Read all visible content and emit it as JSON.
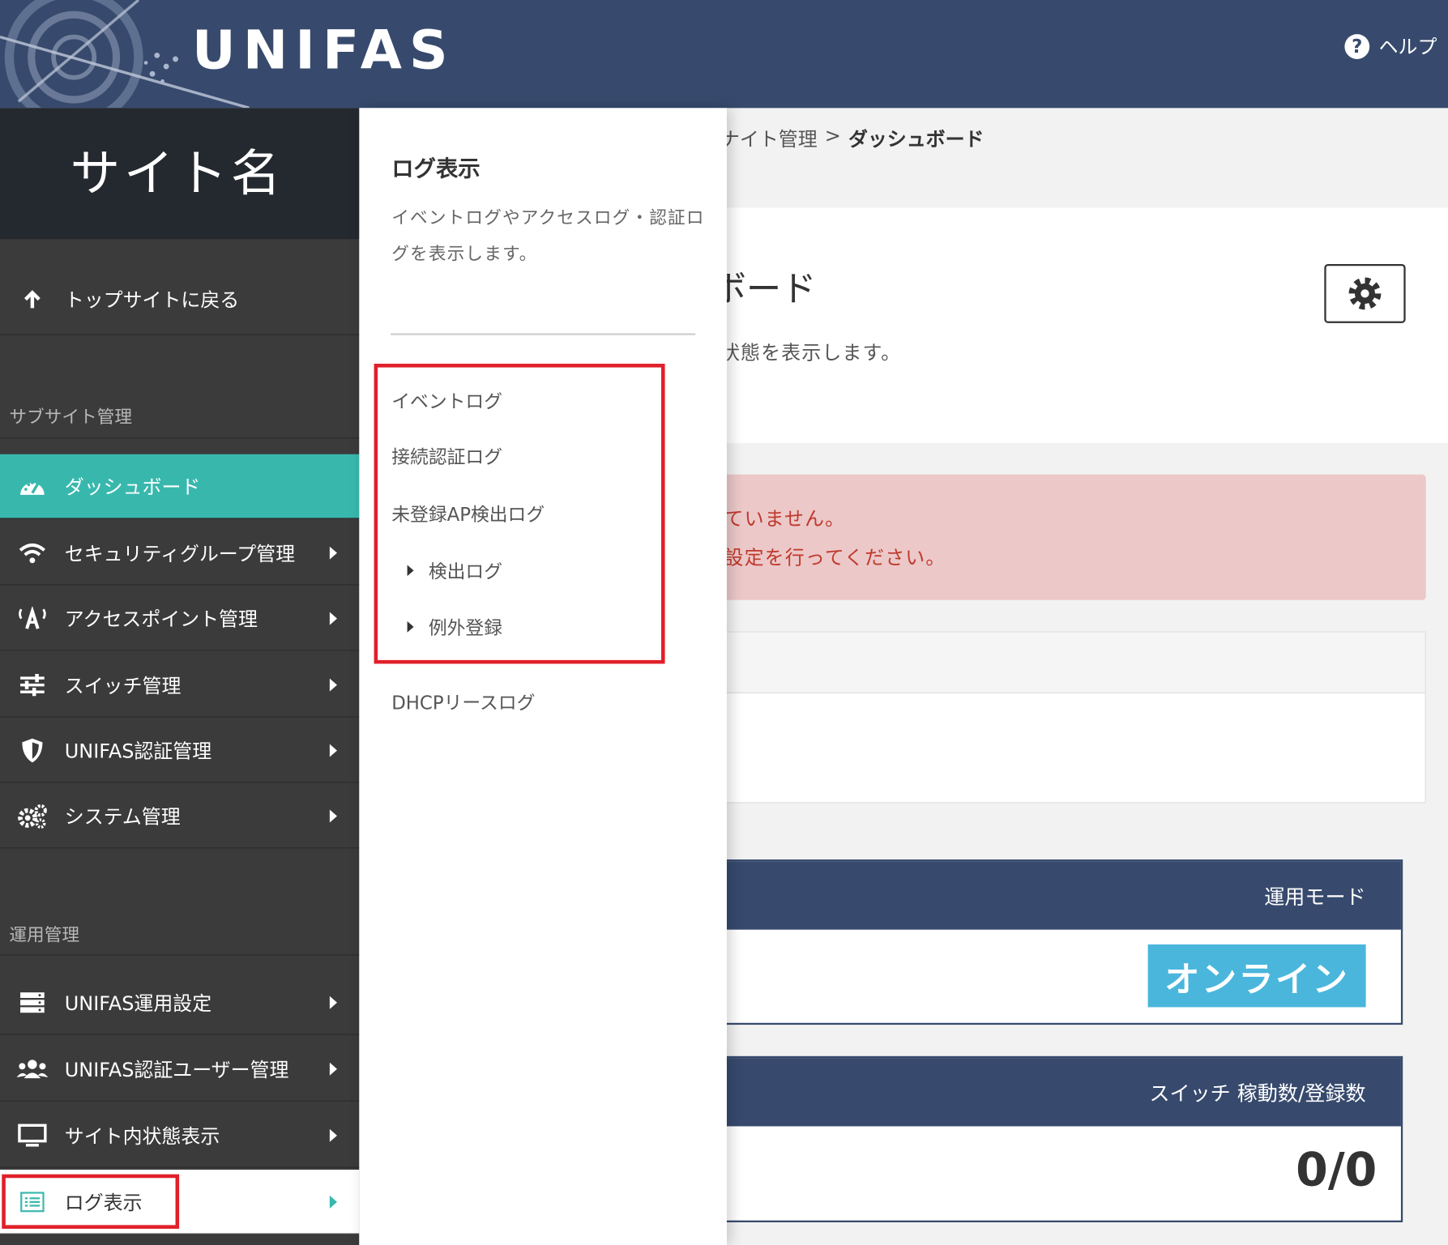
{
  "header": {
    "logo_text": "UNIFAS",
    "help_icon": "question-circle-icon",
    "help_label": "ヘルプ"
  },
  "sidebar": {
    "site_name": "サイト名",
    "back_label": "トップサイトに戻る",
    "back_icon": "arrow-up-icon",
    "section_subsite": "サブサイト管理",
    "section_ops": "運用管理",
    "items": [
      {
        "label": "ダッシュボード",
        "icon": "dashboard-gauge-icon",
        "state": "active"
      },
      {
        "label": "セキュリティグループ管理",
        "icon": "wifi-icon"
      },
      {
        "label": "アクセスポイント管理",
        "icon": "access-point-icon"
      },
      {
        "label": "スイッチ管理",
        "icon": "sliders-icon"
      },
      {
        "label": "UNIFAS認証管理",
        "icon": "shield-icon"
      },
      {
        "label": "システム管理",
        "icon": "cogs-icon"
      },
      {
        "label": "UNIFAS運用設定",
        "icon": "server-icon"
      },
      {
        "label": "UNIFAS認証ユーザー管理",
        "icon": "users-icon"
      },
      {
        "label": "サイト内状態表示",
        "icon": "monitor-icon"
      },
      {
        "label": "ログ表示",
        "icon": "list-icon",
        "state": "selected"
      }
    ],
    "accent_color": "#38b8ad",
    "bg_color": "#3b3b3b"
  },
  "flyout": {
    "title": "ログ表示",
    "description": "イベントログやアクセスログ・認証ログを表示します。",
    "links": {
      "event_log": "イベントログ",
      "connection_auth_log": "接続認証ログ",
      "unregistered_ap_log": "未登録AP検出ログ",
      "detection_log": "検出ログ",
      "exception_registration": "例外登録",
      "dhcp_lease_log": "DHCPリースログ"
    }
  },
  "main": {
    "breadcrumb_parent": "ナイト管理",
    "breadcrumb_sep": ">",
    "breadcrumb_current": "ダッシュボード",
    "page_title": "ボード",
    "page_description": "状態を表示します。",
    "settings_icon": "gear-icon",
    "alert_line1": "ていません。",
    "alert_line2": "設定を行ってください。",
    "alert_color": "#ecc8c9",
    "cards": {
      "mode_header": "運用モード",
      "mode_value": "オンライン",
      "switch_header": "スイッチ 稼動数/登録数",
      "switch_value": "0/0"
    },
    "header_color": "#374a6d",
    "badge_color": "#4ab6dc"
  },
  "highlight_color": "#e0202a"
}
